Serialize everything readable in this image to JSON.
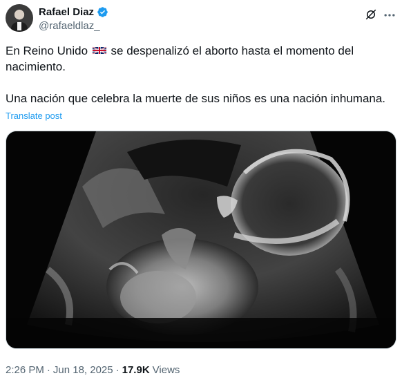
{
  "author": {
    "display_name": "Rafael Diaz",
    "handle": "@rafaeldlaz_",
    "verified": true,
    "verified_color": "#1d9bf0"
  },
  "icons": {
    "verified": "verified-badge-icon",
    "grok": "grok-icon",
    "more": "more-options-icon",
    "flag": "uk-flag-icon"
  },
  "tweet": {
    "line1_before_flag": "En Reino Unido",
    "line1_after_flag": "se despenalizó el aborto hasta el momento del nacimiento.",
    "line2": "Una nación que celebra la muerte de sus niños es una nación inhumana.",
    "translate_label": "Translate post"
  },
  "media": {
    "kind": "ultrasound-image"
  },
  "meta": {
    "time": "2:26 PM",
    "separator": "·",
    "date": "Jun 18, 2025",
    "views_count": "17.9K",
    "views_label": "Views"
  },
  "colors": {
    "text": "#0f1419",
    "secondary": "#536471",
    "link": "#1d9bf0"
  }
}
